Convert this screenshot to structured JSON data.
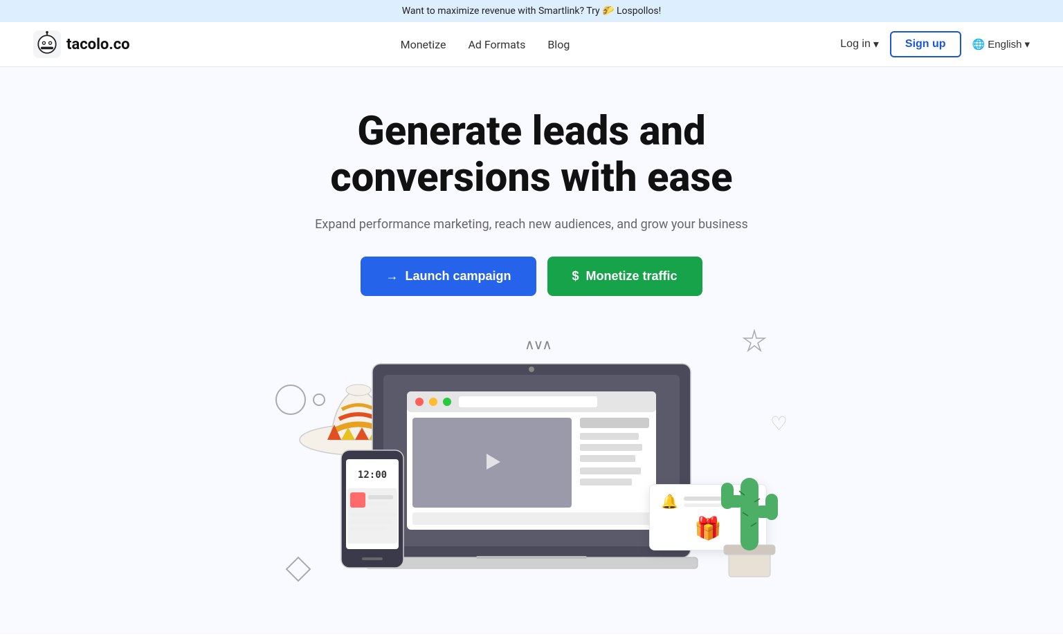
{
  "banner": {
    "text": "Want to maximize revenue with Smartlink? Try 🌮 Lospollos!"
  },
  "navbar": {
    "logo_text": "tacolo.co",
    "links": [
      {
        "id": "monetize",
        "label": "Monetize"
      },
      {
        "id": "ad-formats",
        "label": "Ad Formats"
      },
      {
        "id": "blog",
        "label": "Blog"
      }
    ],
    "login_label": "Log in",
    "signup_label": "Sign up",
    "lang_label": "English"
  },
  "hero": {
    "title_line1": "Generate leads and",
    "title_line2": "conversions with ease",
    "subtitle": "Expand performance marketing, reach new audiences, and grow your business",
    "btn_launch": "Launch campaign",
    "btn_monetize": "Monetize traffic"
  },
  "icons": {
    "arrow_right": "→",
    "dollar": "$",
    "globe": "🌐",
    "chevron_down": "▾"
  }
}
